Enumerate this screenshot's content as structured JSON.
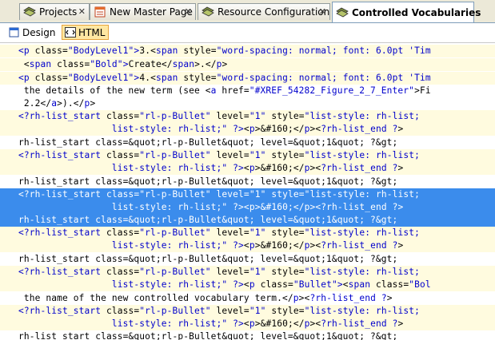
{
  "tabs": [
    {
      "label": "Projects",
      "icon": "projects-icon",
      "active": false
    },
    {
      "label": "New Master Page",
      "icon": "master-page-icon",
      "active": false
    },
    {
      "label": "Resource Configuration",
      "icon": "resource-config-icon",
      "active": false
    },
    {
      "label": "Controlled Vocabularies",
      "icon": "vocabularies-icon",
      "active": true
    }
  ],
  "close_glyph": "✕",
  "view": {
    "design_label": "Design",
    "html_label": "HTML",
    "active": "HTML"
  },
  "code_lines": [
    {
      "hl": true,
      "segs": [
        [
          "tag",
          "<p "
        ],
        [
          "attr",
          "class="
        ],
        [
          "val",
          "\"BodyLevel1\""
        ],
        [
          "tag",
          ">"
        ],
        [
          "txt",
          "3.<"
        ],
        [
          "tag",
          "span "
        ],
        [
          "attr",
          "style="
        ],
        [
          "val",
          "\"word-spacing: normal; font: 6.0pt 'Tim"
        ]
      ]
    },
    {
      "hl": true,
      "segs": [
        [
          "txt",
          " <"
        ],
        [
          "tag",
          "span "
        ],
        [
          "attr",
          "class="
        ],
        [
          "val",
          "\"Bold\""
        ],
        [
          "tag",
          ">"
        ],
        [
          "txt",
          "Create</"
        ],
        [
          "tag",
          "span"
        ],
        [
          "txt",
          ">.</"
        ],
        [
          "tag",
          "p"
        ],
        [
          "txt",
          ">"
        ]
      ]
    },
    {
      "hl": true,
      "segs": [
        [
          "tag",
          "<p "
        ],
        [
          "attr",
          "class="
        ],
        [
          "val",
          "\"BodyLevel1\""
        ],
        [
          "tag",
          ">"
        ],
        [
          "txt",
          "4.<"
        ],
        [
          "tag",
          "span "
        ],
        [
          "attr",
          "style="
        ],
        [
          "val",
          "\"word-spacing: normal; font: 6.0pt 'Tim"
        ]
      ]
    },
    {
      "hl": false,
      "segs": [
        [
          "txt",
          " the details of the new term (see <"
        ],
        [
          "tag",
          "a "
        ],
        [
          "attr",
          "href="
        ],
        [
          "val",
          "\"#XREF_54282_Figure_2_7_Enter\""
        ],
        [
          "txt",
          ">Fi"
        ]
      ]
    },
    {
      "hl": false,
      "segs": [
        [
          "txt",
          " 2.2</"
        ],
        [
          "tag",
          "a"
        ],
        [
          "txt",
          ">).</"
        ],
        [
          "tag",
          "p"
        ],
        [
          "txt",
          ">"
        ]
      ]
    },
    {
      "hl": true,
      "segs": [
        [
          "tag",
          "<?rh-list_start "
        ],
        [
          "attr",
          "class="
        ],
        [
          "val",
          "\"rl-p-Bullet\" "
        ],
        [
          "attr",
          "level="
        ],
        [
          "val",
          "\"1\" "
        ],
        [
          "attr",
          "style="
        ],
        [
          "val",
          "\"list-style: rh-list;"
        ]
      ]
    },
    {
      "hl": true,
      "segs": [
        [
          "txt",
          "                 "
        ],
        [
          "val",
          "list-style: rh-list;\" "
        ],
        [
          "tag",
          "?>"
        ],
        [
          "txt",
          "<"
        ],
        [
          "tag",
          "p"
        ],
        [
          "txt",
          ">"
        ],
        [
          "ent",
          "&#160;"
        ],
        [
          "txt",
          "</"
        ],
        [
          "tag",
          "p"
        ],
        [
          "txt",
          "><"
        ],
        [
          "tag",
          "?rh-list_end ?"
        ],
        [
          "txt",
          ">"
        ]
      ]
    },
    {
      "hl": false,
      "segs": [
        [
          "txt",
          "rh-list_start class=&quot;rl-p-Bullet&quot; level=&quot;1&quot; ?&gt;"
        ]
      ]
    },
    {
      "hl": true,
      "segs": [
        [
          "tag",
          "<?rh-list_start "
        ],
        [
          "attr",
          "class="
        ],
        [
          "val",
          "\"rl-p-Bullet\" "
        ],
        [
          "attr",
          "level="
        ],
        [
          "val",
          "\"1\" "
        ],
        [
          "attr",
          "style="
        ],
        [
          "val",
          "\"list-style: rh-list;"
        ]
      ]
    },
    {
      "hl": true,
      "segs": [
        [
          "txt",
          "                 "
        ],
        [
          "val",
          "list-style: rh-list;\" "
        ],
        [
          "tag",
          "?>"
        ],
        [
          "txt",
          "<"
        ],
        [
          "tag",
          "p"
        ],
        [
          "txt",
          ">"
        ],
        [
          "ent",
          "&#160;"
        ],
        [
          "txt",
          "</"
        ],
        [
          "tag",
          "p"
        ],
        [
          "txt",
          "><"
        ],
        [
          "tag",
          "?rh-list_end ?"
        ],
        [
          "txt",
          ">"
        ]
      ]
    },
    {
      "hl": false,
      "segs": [
        [
          "txt",
          "rh-list_start class=&quot;rl-p-Bullet&quot; level=&quot;1&quot; ?&gt;"
        ]
      ]
    },
    {
      "sel": true,
      "segs": [
        [
          "tag",
          "<?rh-list_start "
        ],
        [
          "attr",
          "class="
        ],
        [
          "val",
          "\"rl-p-Bullet\" "
        ],
        [
          "attr",
          "level="
        ],
        [
          "val",
          "\"1\" "
        ],
        [
          "attr",
          "style="
        ],
        [
          "val",
          "\"list-style: rh-list;"
        ]
      ]
    },
    {
      "sel": true,
      "segs": [
        [
          "txt",
          "                 "
        ],
        [
          "val",
          "list-style: rh-list;\" "
        ],
        [
          "tag",
          "?>"
        ],
        [
          "txt",
          "<"
        ],
        [
          "tag",
          "p"
        ],
        [
          "txt",
          ">"
        ],
        [
          "ent",
          "&#160;"
        ],
        [
          "txt",
          "</"
        ],
        [
          "tag",
          "p"
        ],
        [
          "txt",
          "><"
        ],
        [
          "tag",
          "?rh-list_end ?"
        ],
        [
          "txt",
          ">"
        ]
      ]
    },
    {
      "sel": true,
      "segs": [
        [
          "txt",
          "rh-list_start class=&quot;rl-p-Bullet&quot; level=&quot;1&quot; ?&gt;"
        ]
      ]
    },
    {
      "hl": true,
      "segs": [
        [
          "tag",
          "<?rh-list_start "
        ],
        [
          "attr",
          "class="
        ],
        [
          "val",
          "\"rl-p-Bullet\" "
        ],
        [
          "attr",
          "level="
        ],
        [
          "val",
          "\"1\" "
        ],
        [
          "attr",
          "style="
        ],
        [
          "val",
          "\"list-style: rh-list;"
        ]
      ]
    },
    {
      "hl": true,
      "segs": [
        [
          "txt",
          "                 "
        ],
        [
          "val",
          "list-style: rh-list;\" "
        ],
        [
          "tag",
          "?>"
        ],
        [
          "txt",
          "<"
        ],
        [
          "tag",
          "p"
        ],
        [
          "txt",
          ">"
        ],
        [
          "ent",
          "&#160;"
        ],
        [
          "txt",
          "</"
        ],
        [
          "tag",
          "p"
        ],
        [
          "txt",
          "><"
        ],
        [
          "tag",
          "?rh-list_end ?"
        ],
        [
          "txt",
          ">"
        ]
      ]
    },
    {
      "hl": false,
      "segs": [
        [
          "txt",
          "rh-list_start class=&quot;rl-p-Bullet&quot; level=&quot;1&quot; ?&gt;"
        ]
      ]
    },
    {
      "hl": true,
      "segs": [
        [
          "tag",
          "<?rh-list_start "
        ],
        [
          "attr",
          "class="
        ],
        [
          "val",
          "\"rl-p-Bullet\" "
        ],
        [
          "attr",
          "level="
        ],
        [
          "val",
          "\"1\" "
        ],
        [
          "attr",
          "style="
        ],
        [
          "val",
          "\"list-style: rh-list;"
        ]
      ]
    },
    {
      "hl": true,
      "segs": [
        [
          "txt",
          "                 "
        ],
        [
          "val",
          "list-style: rh-list;\" "
        ],
        [
          "tag",
          "?>"
        ],
        [
          "txt",
          "<"
        ],
        [
          "tag",
          "p "
        ],
        [
          "attr",
          "class="
        ],
        [
          "val",
          "\"Bullet\""
        ],
        [
          "tag",
          ">"
        ],
        [
          "txt",
          "<"
        ],
        [
          "tag",
          "span "
        ],
        [
          "attr",
          "class="
        ],
        [
          "val",
          "\"Bol"
        ]
      ]
    },
    {
      "hl": false,
      "segs": [
        [
          "txt",
          " the name of the new controlled vocabulary term.</"
        ],
        [
          "tag",
          "p"
        ],
        [
          "txt",
          "><"
        ],
        [
          "tag",
          "?rh-list_end ?"
        ],
        [
          "txt",
          ">"
        ]
      ]
    },
    {
      "hl": true,
      "segs": [
        [
          "tag",
          "<?rh-list_start "
        ],
        [
          "attr",
          "class="
        ],
        [
          "val",
          "\"rl-p-Bullet\" "
        ],
        [
          "attr",
          "level="
        ],
        [
          "val",
          "\"1\" "
        ],
        [
          "attr",
          "style="
        ],
        [
          "val",
          "\"list-style: rh-list;"
        ]
      ]
    },
    {
      "hl": true,
      "segs": [
        [
          "txt",
          "                 "
        ],
        [
          "val",
          "list-style: rh-list;\" "
        ],
        [
          "tag",
          "?>"
        ],
        [
          "txt",
          "<"
        ],
        [
          "tag",
          "p"
        ],
        [
          "txt",
          ">"
        ],
        [
          "ent",
          "&#160;"
        ],
        [
          "txt",
          "</"
        ],
        [
          "tag",
          "p"
        ],
        [
          "txt",
          "><"
        ],
        [
          "tag",
          "?rh-list_end ?"
        ],
        [
          "txt",
          ">"
        ]
      ]
    },
    {
      "hl": false,
      "segs": [
        [
          "txt",
          "rh-list_start class=&quot;rl-p-Bullet&quot; level=&quot;1&quot; ?&gt;"
        ]
      ]
    },
    {
      "hl": true,
      "segs": [
        [
          "tag",
          "<?rh-list_start "
        ],
        [
          "attr",
          "class="
        ],
        [
          "val",
          "\"rl-p-Bullet\" "
        ],
        [
          "attr",
          "level="
        ],
        [
          "val",
          "\"1\" "
        ],
        [
          "attr",
          "style="
        ],
        [
          "val",
          "\"list-style: rh-list;"
        ]
      ]
    }
  ]
}
